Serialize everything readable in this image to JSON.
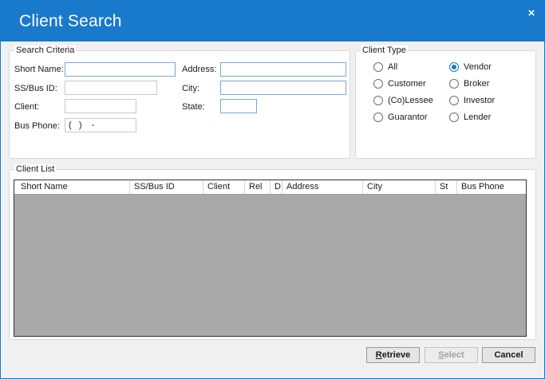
{
  "window": {
    "title": "Client Search",
    "close_glyph": "×"
  },
  "criteria": {
    "legend": "Search Criteria",
    "short_name_label": "Short Name:",
    "ssbus_label": "SS/Bus ID:",
    "client_label": "Client:",
    "bus_phone_label": "Bus Phone:",
    "bus_phone_value": "(   )    -",
    "address_label": "Address:",
    "city_label": "City:",
    "state_label": "State:"
  },
  "client_type": {
    "legend": "Client Type",
    "options": [
      "All",
      "Customer",
      "(Co)Lessee",
      "Guarantor",
      "Vendor",
      "Broker",
      "Investor",
      "Lender"
    ],
    "selected": "Vendor"
  },
  "client_list": {
    "legend": "Client List",
    "columns": [
      "Short Name",
      "SS/Bus ID",
      "Client",
      "Rel",
      "D",
      "Address",
      "City",
      "St",
      "Bus Phone"
    ]
  },
  "buttons": {
    "retrieve_first": "R",
    "retrieve_rest": "etrieve",
    "select_first": "S",
    "select_rest": "elect",
    "cancel": "Cancel"
  },
  "colors": {
    "accent": "#1979ca",
    "grid_bg": "#a9a9a9"
  }
}
